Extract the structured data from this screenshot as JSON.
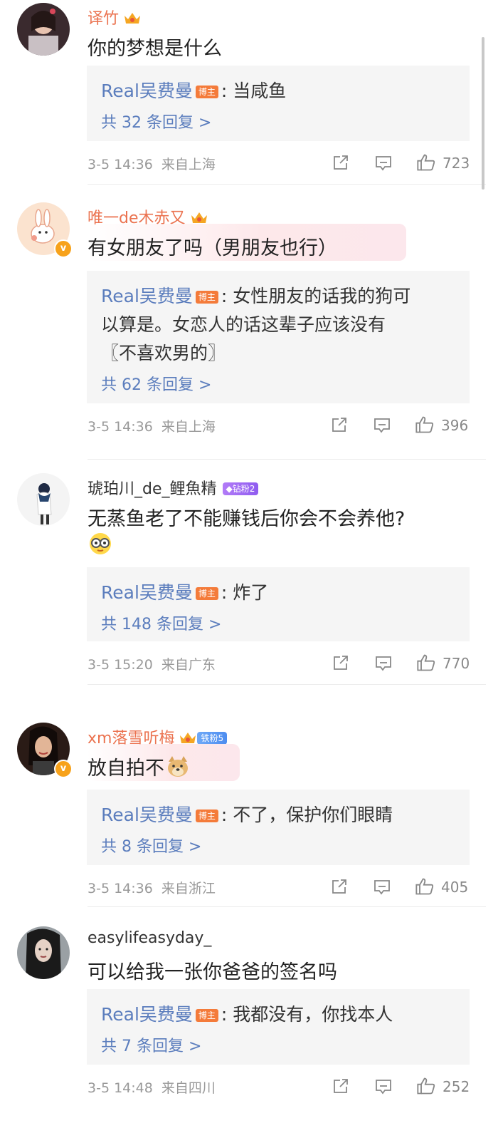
{
  "colors": {
    "accent_orange": "#eb7350",
    "link_blue": "#5b7dbd",
    "meta_gray": "#999999",
    "reply_bg": "#f5f5f5"
  },
  "comments": [
    {
      "username": "译竹",
      "text": "你的梦想是什么",
      "reply_author": "Real吴费曼",
      "blogger_badge": "博主",
      "reply_lines": [
        ": 当咸鱼"
      ],
      "reply_count": "共 32 条回复 >",
      "time": "3-5 14:36",
      "location": "来自上海",
      "likes": "723"
    },
    {
      "username": "唯一de木赤又",
      "text": "有女朋友了吗（男朋友也行）",
      "reply_author": "Real吴费曼",
      "blogger_badge": "博主",
      "reply_lines": [
        ": 女性朋友的话我的狗可",
        "以算是。女恋人的话这辈子应该没有",
        "〖不喜欢男的〗"
      ],
      "reply_count": "共 62 条回复 >",
      "time": "3-5 14:36",
      "location": "来自上海",
      "likes": "396"
    },
    {
      "username": "琥珀川_de_鲤魚精",
      "fan_badge": "钻粉2",
      "text": "无蒸鱼老了不能赚钱后你会不会养他?",
      "reply_author": "Real吴费曼",
      "blogger_badge": "博主",
      "reply_lines": [
        ": 炸了"
      ],
      "reply_count": "共 148 条回复 >",
      "time": "3-5 15:20",
      "location": "来自广东",
      "likes": "770"
    },
    {
      "username": "xm落雪听梅",
      "fan_badge": "铁粉5",
      "text": "放自拍不",
      "reply_author": "Real吴费曼",
      "blogger_badge": "博主",
      "reply_lines": [
        ": 不了，保护你们眼睛"
      ],
      "reply_count": "共 8 条回复 >",
      "time": "3-5 14:36",
      "location": "来自浙江",
      "likes": "405"
    },
    {
      "username": "easylifeasyday_",
      "text": "可以给我一张你爸爸的签名吗",
      "reply_author": "Real吴费曼",
      "blogger_badge": "博主",
      "reply_lines": [
        ": 我都没有，你找本人"
      ],
      "reply_count": "共 7 条回复 >",
      "time": "3-5 14:48",
      "location": "来自四川",
      "likes": "252"
    }
  ]
}
